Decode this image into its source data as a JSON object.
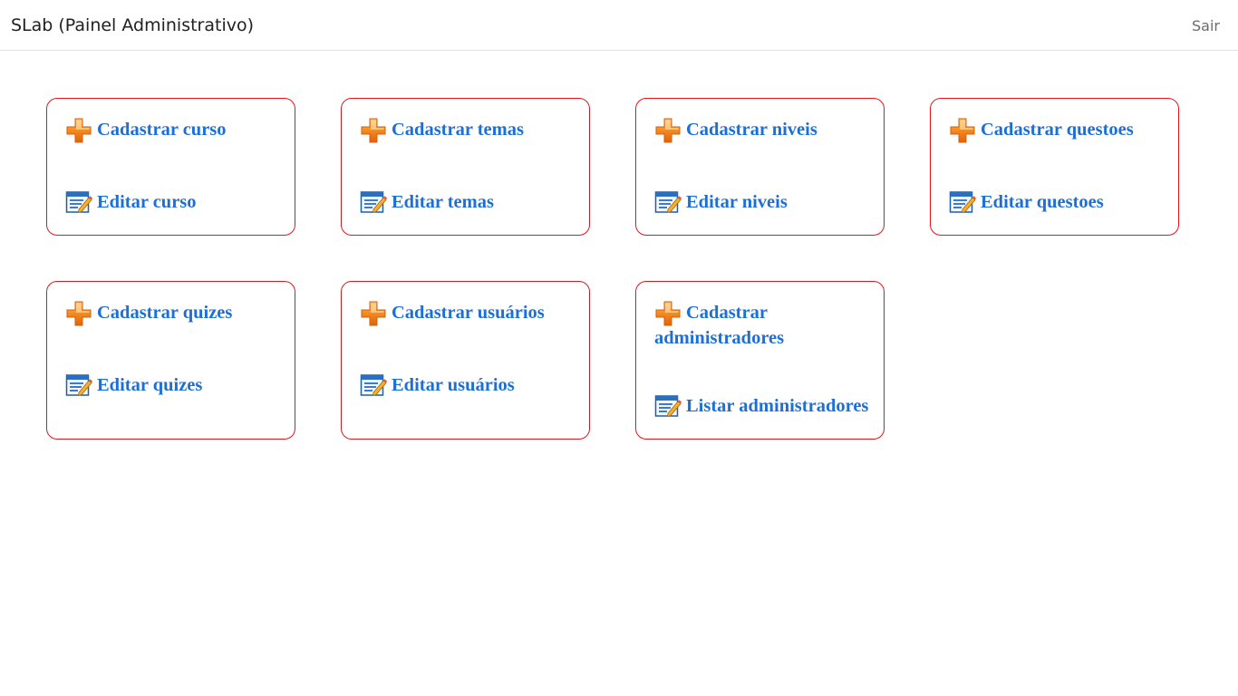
{
  "header": {
    "brand": "SLab (Painel Administrativo)",
    "logout_label": "Sair"
  },
  "cards": [
    {
      "add_label": "Cadastrar curso",
      "edit_label": "Editar curso"
    },
    {
      "add_label": "Cadastrar temas",
      "edit_label": "Editar temas"
    },
    {
      "add_label": "Cadastrar niveis",
      "edit_label": "Editar niveis"
    },
    {
      "add_label": "Cadastrar questoes",
      "edit_label": "Editar questoes"
    },
    {
      "add_label": "Cadastrar quizes",
      "edit_label": "Editar quizes"
    },
    {
      "add_label": "Cadastrar usuários",
      "edit_label": "Editar usuários"
    },
    {
      "add_label": "Cadastrar administradores",
      "edit_label": "Listar administradores"
    }
  ],
  "icons": {
    "add": "plus-icon",
    "edit": "edit-form-icon"
  },
  "colors": {
    "card_border": "#e0161b",
    "link": "#1d6fd8",
    "plus_icon": "#f07a14"
  }
}
